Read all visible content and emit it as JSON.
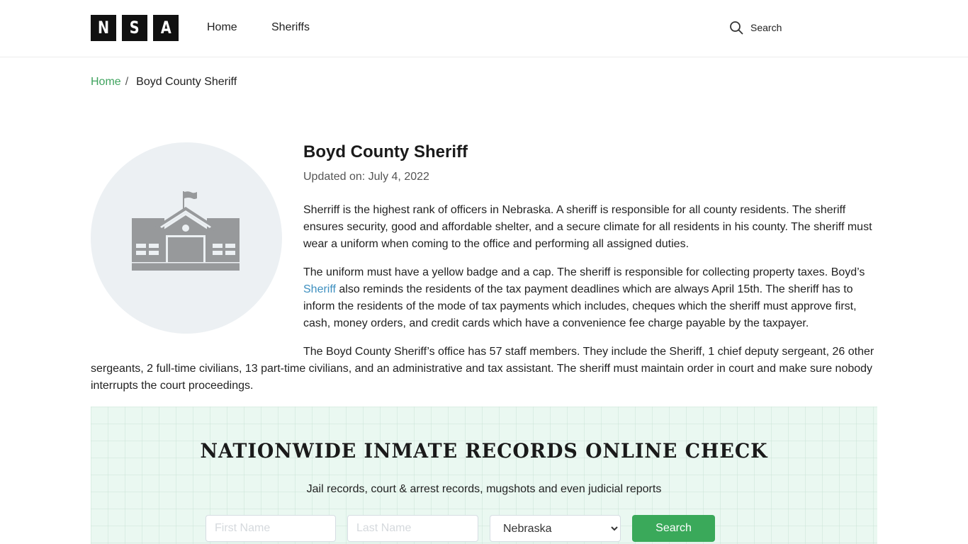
{
  "header": {
    "logo_letters": [
      "N",
      "S",
      "A"
    ],
    "nav": [
      {
        "label": "Home"
      },
      {
        "label": "Sheriffs"
      }
    ],
    "search_label": "Search",
    "search_icon": "search-icon"
  },
  "breadcrumb": {
    "home": "Home",
    "separator": "/",
    "current": "Boyd County Sheriff"
  },
  "hero": {
    "icon": "building-courthouse-icon"
  },
  "article": {
    "title": "Boyd County Sheriff",
    "updated": "Updated on: July 4, 2022",
    "paragraph1": "Sherriff is the highest rank of officers in Nebraska. A sheriff is responsible for all county residents. The sheriff ensures security, good and affordable shelter, and a secure climate for all residents in his county. The sheriff must wear a uniform when coming to the office and performing all assigned duties.",
    "paragraph2_before": "The uniform must have a yellow badge and a cap. The sheriff is responsible for collecting property taxes. Boyd’s ",
    "paragraph2_link": "Sheriff",
    "paragraph2_after": " also reminds the residents of the tax payment deadlines which are always April 15th. The sheriff has to inform the residents of the mode of tax payments which includes, cheques which the sheriff must approve first, cash, money orders, and credit cards which have a convenience fee charge payable by the taxpayer.",
    "paragraph3": "The Boyd County Sheriff’s office has 57 staff members. They include the Sheriff, 1 chief deputy sergeant, 26 other sergeants, 2 full-time civilians, 13 part-time civilians, and an administrative and tax assistant.  The sheriff must maintain order in court and make sure nobody interrupts the court proceedings."
  },
  "promo": {
    "title": "NATIONWIDE INMATE RECORDS ONLINE CHECK",
    "subtitle": "Jail records, court & arrest records, mugshots and even judicial reports",
    "first_name": {
      "value": "",
      "placeholder": "First Name"
    },
    "last_name": {
      "value": "",
      "placeholder": "Last Name"
    },
    "state": {
      "selected": "Nebraska"
    },
    "search_button": "Search"
  },
  "colors": {
    "accent_green": "#3aa95a",
    "breadcrumb_link": "#3fa35e",
    "inline_link": "#3d8fbf",
    "promo_bg": "#eaf8f1"
  }
}
